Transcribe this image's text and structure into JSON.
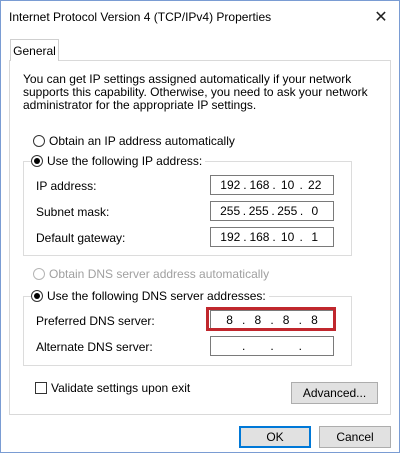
{
  "window": {
    "title": "Internet Protocol Version 4 (TCP/IPv4) Properties"
  },
  "tabs": [
    {
      "label": "General"
    }
  ],
  "info_text": "You can get IP settings assigned automatically if your network supports this capability. Otherwise, you need to ask your network administrator for the appropriate IP settings.",
  "ip_section": {
    "auto_label": "Obtain an IP address automatically",
    "manual_label": "Use the following IP address:",
    "selected": "manual",
    "fields": [
      {
        "label": "IP address:",
        "octets": [
          "192",
          "168",
          "10",
          "22"
        ]
      },
      {
        "label": "Subnet mask:",
        "octets": [
          "255",
          "255",
          "255",
          "0"
        ]
      },
      {
        "label": "Default gateway:",
        "octets": [
          "192",
          "168",
          "10",
          "1"
        ]
      }
    ]
  },
  "dns_section": {
    "auto_label": "Obtain DNS server address automatically",
    "auto_disabled": true,
    "manual_label": "Use the following DNS server addresses:",
    "selected": "manual",
    "fields": [
      {
        "label": "Preferred DNS server:",
        "octets": [
          "8",
          "8",
          "8",
          "8"
        ],
        "highlighted": true
      },
      {
        "label": "Alternate DNS server:",
        "octets": [
          "",
          "",
          "",
          ""
        ],
        "highlighted": false
      }
    ]
  },
  "validate_checkbox": {
    "label": "Validate settings upon exit",
    "checked": false
  },
  "buttons": {
    "advanced": "Advanced...",
    "ok": "OK",
    "cancel": "Cancel"
  },
  "colors": {
    "highlight": "#c0272d",
    "default_button": "#0078d7"
  }
}
